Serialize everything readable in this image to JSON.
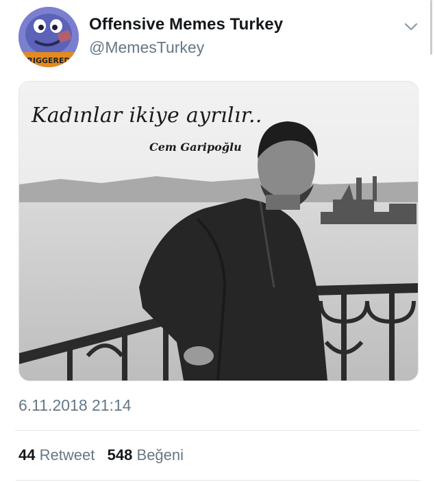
{
  "account": {
    "display_name": "Offensive Memes Turkey",
    "handle": "@MemesTurkey",
    "avatar_badge_text": "RIGGERED"
  },
  "menu": {
    "icon": "chevron-down-icon"
  },
  "media": {
    "quote_text": "Kadınlar ikiye ayrılır..",
    "author_text": "Cem Garipoğlu"
  },
  "timestamp": "6.11.2018 21:14",
  "stats": {
    "retweets_count": "44",
    "retweets_label": "Retweet",
    "likes_count": "548",
    "likes_label": "Beğeni"
  },
  "colors": {
    "primary_text": "#14171a",
    "secondary_text": "#657786",
    "divider": "#e1e8ed"
  }
}
